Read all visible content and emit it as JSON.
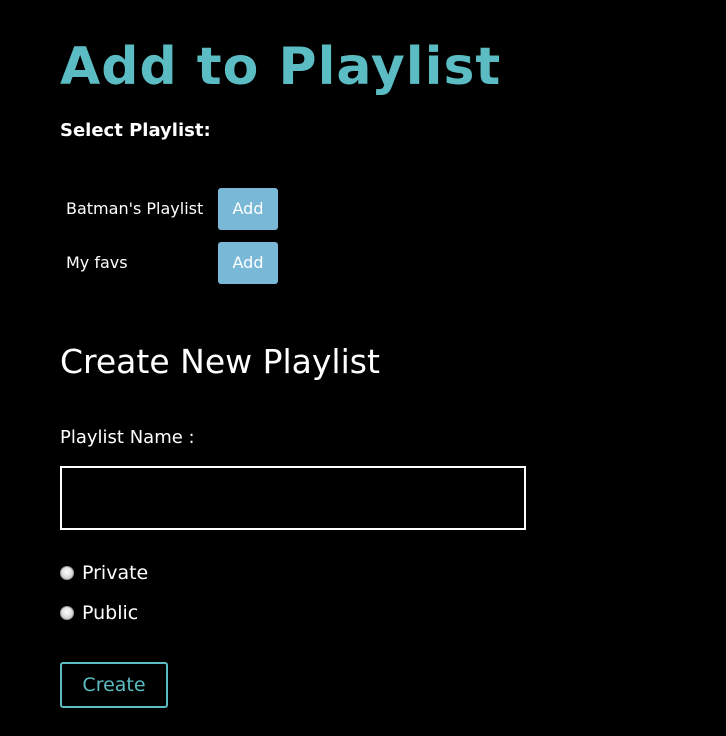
{
  "page": {
    "title": "Add to Playlist",
    "select_label": "Select Playlist:"
  },
  "playlists": [
    {
      "name": "Batman's Playlist",
      "add_label": "Add"
    },
    {
      "name": "My favs",
      "add_label": "Add"
    }
  ],
  "create": {
    "heading": "Create New Playlist",
    "name_label": "Playlist Name :",
    "name_value": "",
    "name_placeholder": "",
    "options": [
      {
        "label": "Private",
        "selected": false
      },
      {
        "label": "Public",
        "selected": false
      }
    ],
    "button_label": "Create"
  },
  "colors": {
    "accent": "#5cbcc3",
    "add_button": "#7ab8d8",
    "background": "#000000"
  }
}
